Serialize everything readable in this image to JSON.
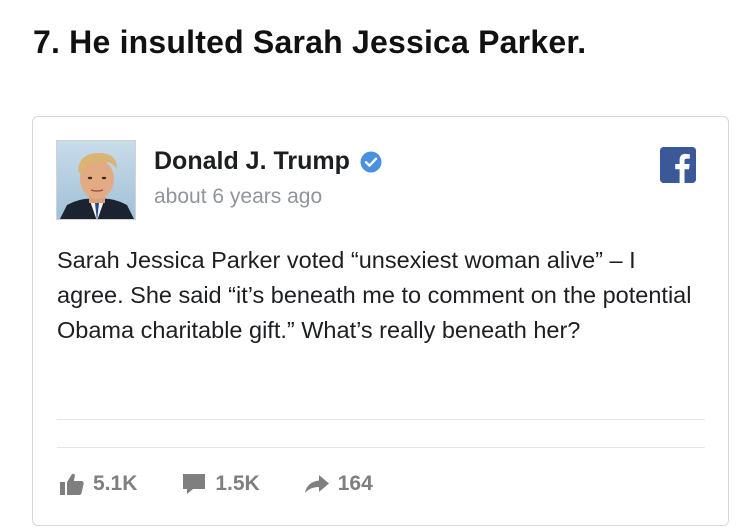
{
  "headline": "7. He insulted Sarah Jessica Parker.",
  "post": {
    "author": "Donald J. Trump",
    "verified": true,
    "timestamp": "about 6 years ago",
    "text": "Sarah Jessica Parker voted “unsexiest woman alive” – I agree. She said “it’s beneath me to comment on the potential Obama charitable gift.” What’s really beneath her?",
    "platform_icon": "facebook-logo-icon",
    "stats": {
      "likes": "5.1K",
      "comments": "1.5K",
      "shares": "164"
    }
  },
  "colors": {
    "facebook_blue": "#3b5998",
    "verified_blue": "#4a90e2",
    "stat_gray": "#7f7f7f",
    "timestamp_gray": "#90949c"
  }
}
